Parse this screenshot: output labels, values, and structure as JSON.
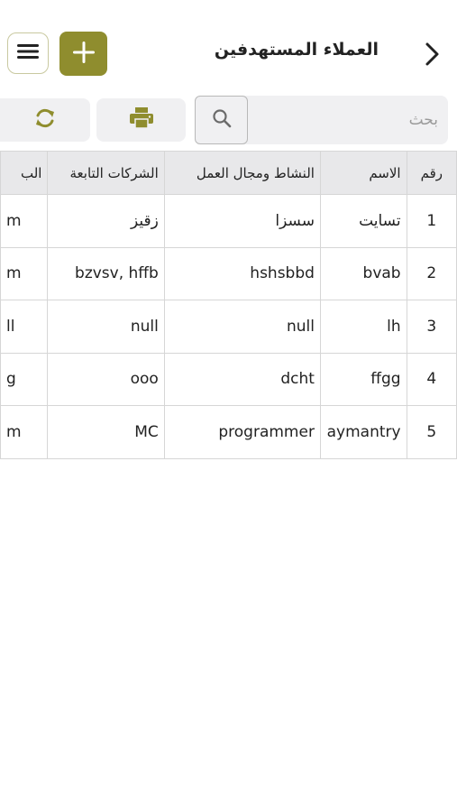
{
  "header": {
    "title": "العملاء المستهدفين",
    "back_icon": "chevron-right-icon",
    "add_icon": "plus-icon",
    "menu_icon": "menu-icon"
  },
  "toolbar": {
    "search_placeholder": "بحث",
    "search_value": "",
    "search_icon": "search-icon",
    "print_icon": "print-icon",
    "refresh_icon": "refresh-icon"
  },
  "table": {
    "headers": [
      "رقم",
      "الاسم",
      "النشاط ومجال العمل",
      "الشركات التابعة",
      "الب"
    ],
    "rows": [
      [
        "1",
        "تسايت",
        "سسزا",
        "زقيز",
        "m"
      ],
      [
        "2",
        "bvab",
        "hshsbbd",
        "bzvsv, hffb",
        "m"
      ],
      [
        "3",
        "lh",
        "null",
        "null",
        "ll"
      ],
      [
        "4",
        "ffgg",
        "dcht",
        "ooo",
        "g"
      ],
      [
        "5",
        "aymantry",
        "programmer",
        "MC",
        "m"
      ]
    ]
  },
  "colors": {
    "accent": "#8f8d2e",
    "toolbar_bg": "#f0f0f2",
    "header_row_bg": "#e8e8ea"
  }
}
